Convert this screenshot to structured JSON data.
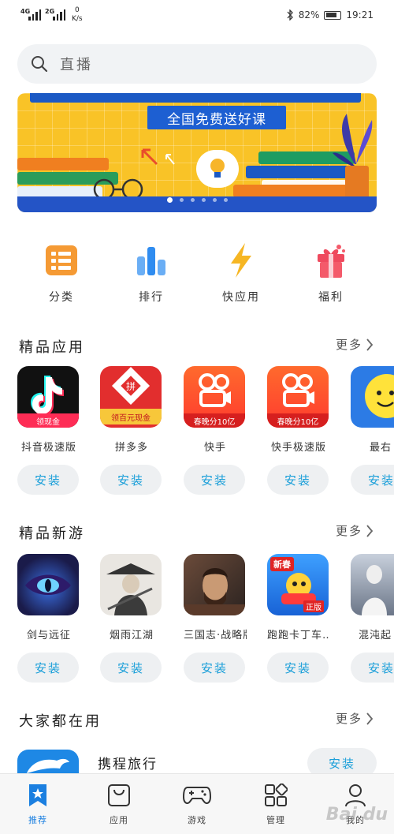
{
  "status_bar": {
    "signal1": "4G",
    "signal2": "2G",
    "net_speed_value": "0",
    "net_speed_unit": "K/s",
    "battery": "82%",
    "time": "19:21"
  },
  "search": {
    "placeholder": "直播"
  },
  "banner": {
    "title": "全国免费送好课",
    "page_count": 6,
    "active_page": 1
  },
  "categories": [
    {
      "label": "分类",
      "icon": "category-icon"
    },
    {
      "label": "排行",
      "icon": "ranking-icon"
    },
    {
      "label": "快应用",
      "icon": "quick-app-icon"
    },
    {
      "label": "福利",
      "icon": "gift-icon"
    }
  ],
  "sections": {
    "featured_apps": {
      "title": "精品应用",
      "more": "更多",
      "apps": [
        {
          "name": "抖音极速版",
          "badge": "领现金",
          "install": "安装"
        },
        {
          "name": "拼多多",
          "badge": "领百元现金",
          "install": "安装"
        },
        {
          "name": "快手",
          "badge": "春晚分10亿",
          "install": "安装"
        },
        {
          "name": "快手极速版",
          "badge": "春晚分10亿",
          "install": "安装"
        },
        {
          "name": "最右",
          "install": "安装"
        }
      ]
    },
    "new_games": {
      "title": "精品新游",
      "more": "更多",
      "apps": [
        {
          "name": "剑与远征",
          "install": "安装"
        },
        {
          "name": "烟雨江湖",
          "install": "安装"
        },
        {
          "name": "三国志·战略版",
          "install": "安装"
        },
        {
          "name": "跑跑卡丁车…",
          "badge_top": "新春",
          "badge_bottom": "正版",
          "install": "安装"
        },
        {
          "name": "混沌起",
          "install": "安装"
        }
      ]
    },
    "popular": {
      "title": "大家都在用",
      "more": "更多",
      "item": {
        "name": "携程旅行",
        "install": "安装"
      }
    }
  },
  "bottom_nav": [
    {
      "label": "推荐",
      "active": true
    },
    {
      "label": "应用",
      "active": false
    },
    {
      "label": "游戏",
      "active": false
    },
    {
      "label": "管理",
      "active": false
    },
    {
      "label": "我的",
      "active": false
    }
  ],
  "watermark": "Bai du",
  "colors": {
    "accent": "#1b9fd9",
    "nav_active": "#1b7fe0",
    "banner_bg": "#f9c327"
  }
}
